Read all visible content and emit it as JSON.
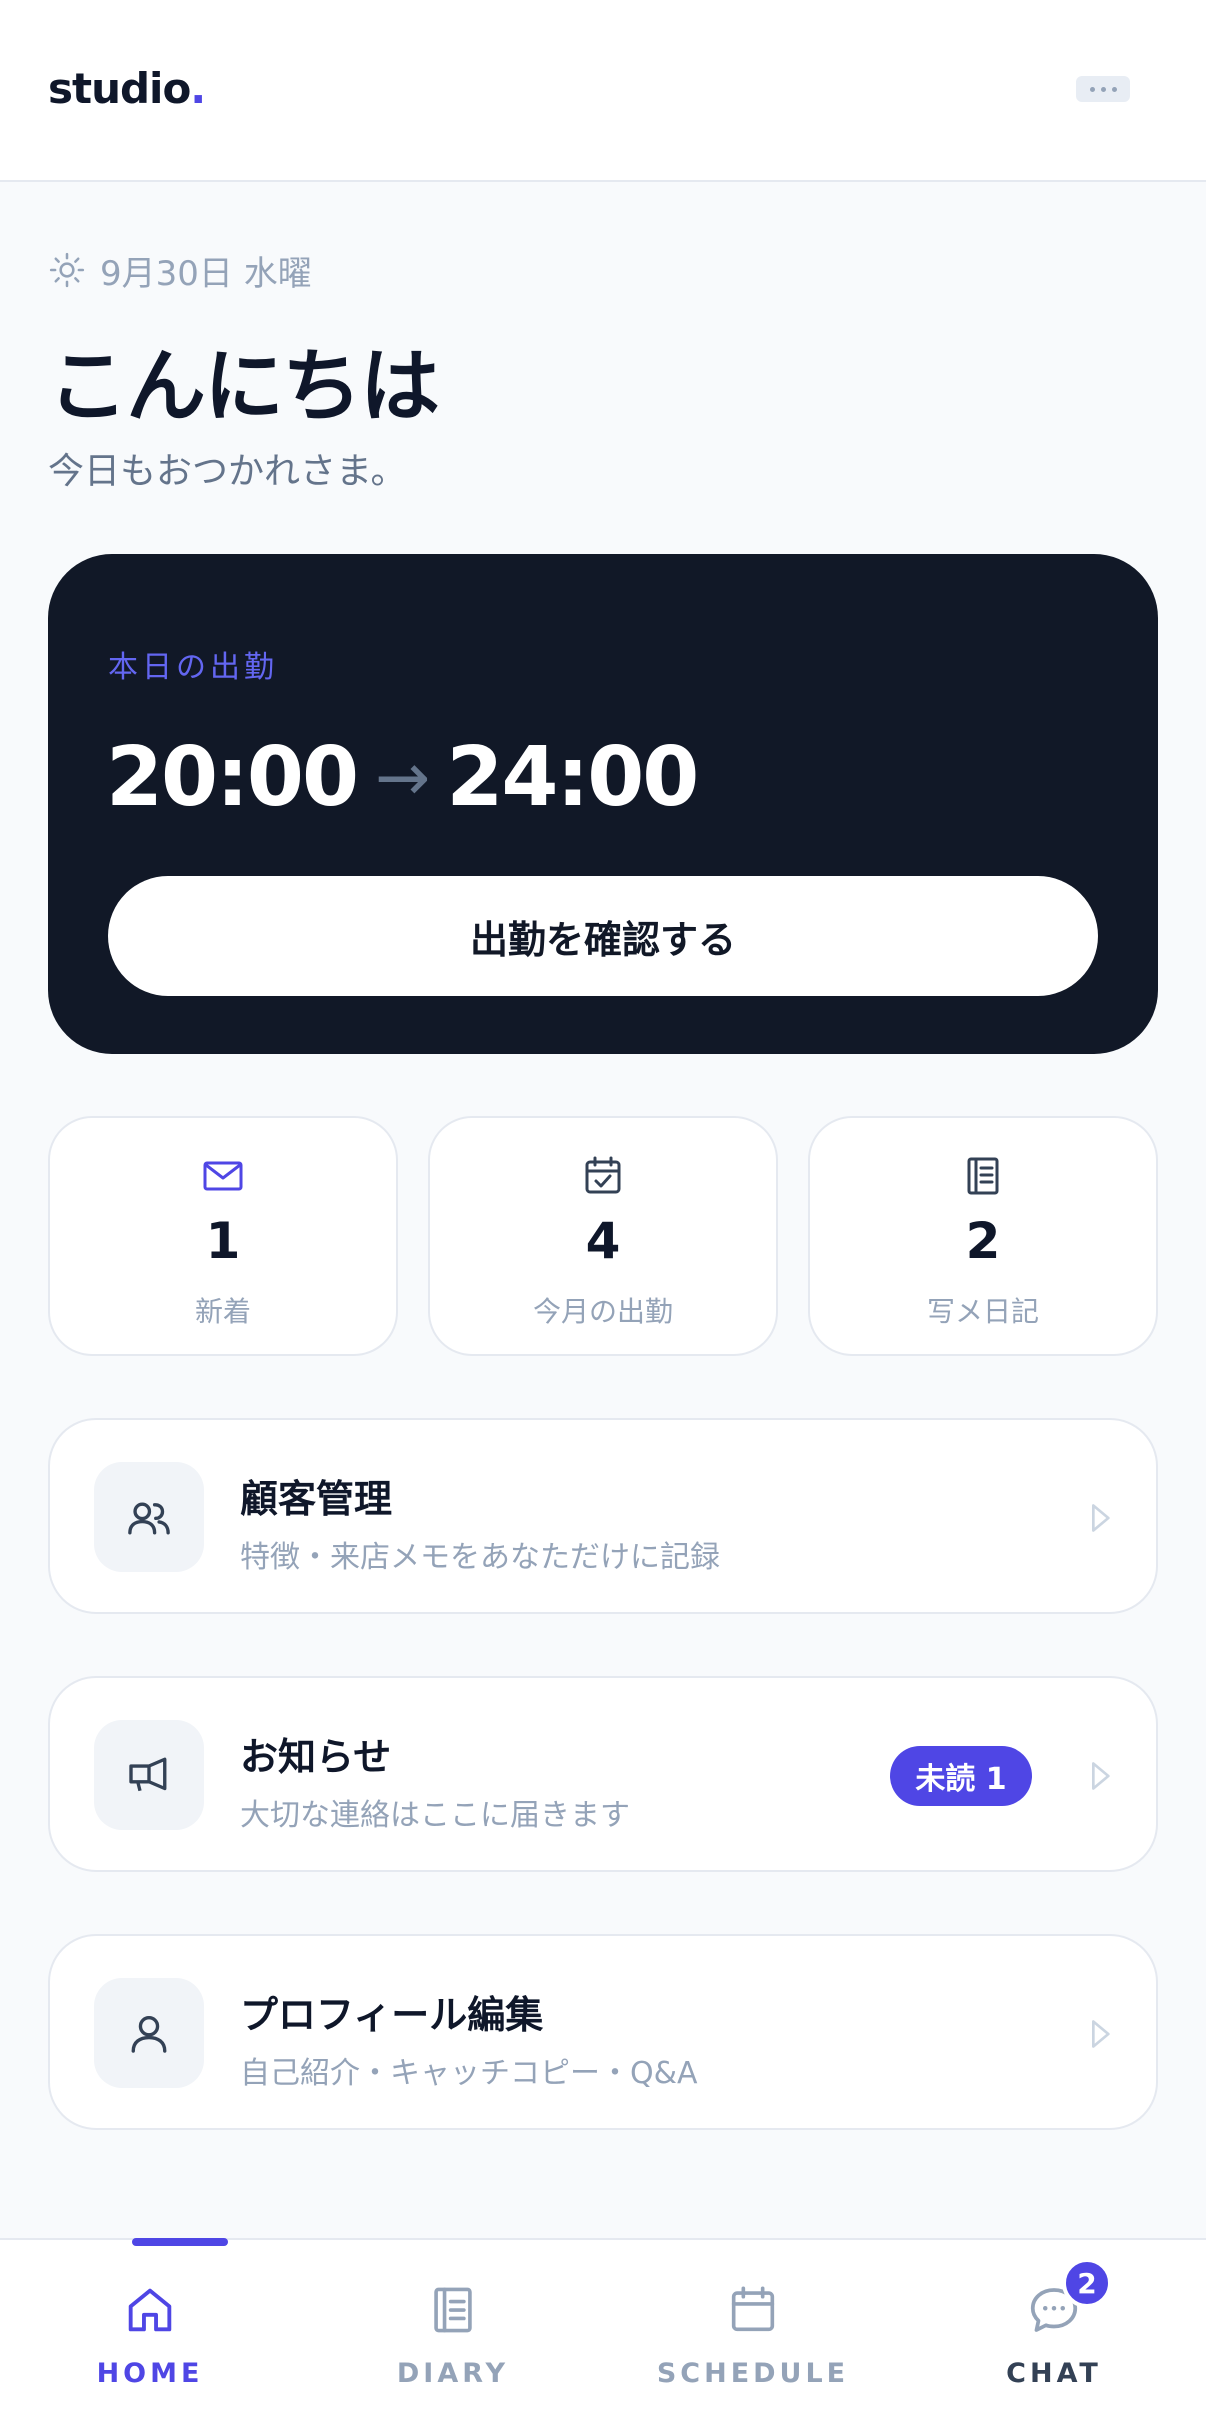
{
  "header": {
    "logo_text": "studio",
    "logo_dot": "."
  },
  "greeting": {
    "date": "9月30日 水曜",
    "title": "こんにちは",
    "subtitle": "今日もおつかれさま。"
  },
  "shift": {
    "label": "本日の出勤",
    "start": "20:00",
    "arrow": "→",
    "end": "24:00",
    "button_label": "出勤を確認する"
  },
  "stats": [
    {
      "icon": "mail-icon",
      "value": "1",
      "label": "新着"
    },
    {
      "icon": "calendar-check-icon",
      "value": "4",
      "label": "今月の出勤"
    },
    {
      "icon": "notebook-icon",
      "value": "2",
      "label": "写メ日記"
    }
  ],
  "menu": [
    {
      "icon": "users-icon",
      "title": "顧客管理",
      "desc": "特徴・来店メモをあなただけに記録"
    },
    {
      "icon": "megaphone-icon",
      "title": "お知らせ",
      "desc": "大切な連絡はここに届きます",
      "badge": "未読 1"
    },
    {
      "icon": "user-icon",
      "title": "プロフィール編集",
      "desc": "自己紹介・キャッチコピー・Q&A"
    }
  ],
  "tabs": [
    {
      "icon": "home-icon",
      "label": "HOME",
      "active": true
    },
    {
      "icon": "diary-icon",
      "label": "DIARY"
    },
    {
      "icon": "calendar-icon",
      "label": "SCHEDULE"
    },
    {
      "icon": "chat-icon",
      "label": "CHAT",
      "badge": "2"
    }
  ],
  "colors": {
    "accent": "#4f46e5",
    "dark_card": "#111827",
    "background": "#f8fafc"
  }
}
